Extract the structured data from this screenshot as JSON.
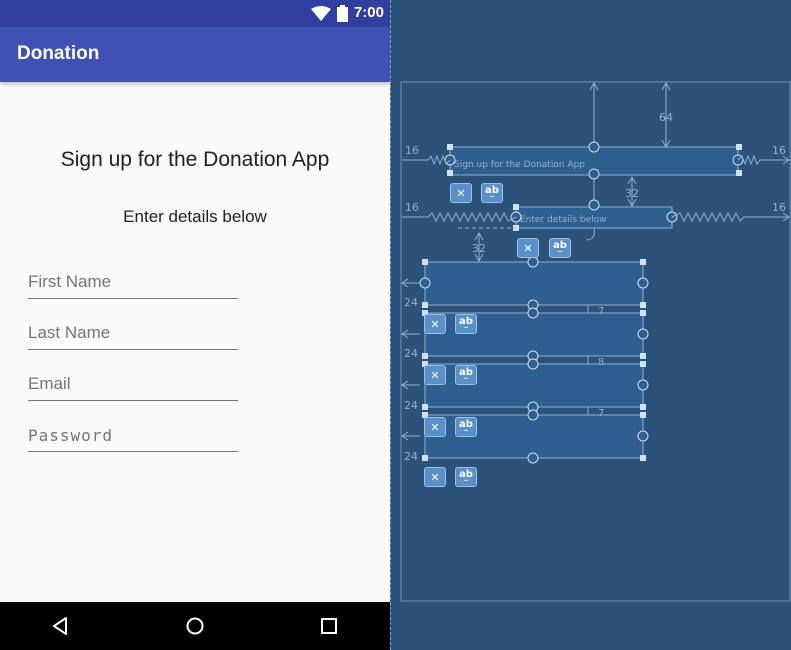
{
  "status_bar": {
    "time": "7:00"
  },
  "app_bar": {
    "title": "Donation"
  },
  "content": {
    "heading": "Sign up for the Donation App",
    "subheading": "Enter details below",
    "fields": {
      "first_name": {
        "placeholder": "First Name"
      },
      "last_name": {
        "placeholder": "Last Name"
      },
      "email": {
        "placeholder": "Email"
      },
      "password": {
        "placeholder": "Password"
      }
    }
  },
  "nav_bar": {
    "icons": [
      "back-icon",
      "home-icon",
      "recents-icon"
    ]
  },
  "blueprint": {
    "margins": {
      "left_top": "16",
      "right_top": "16",
      "left_sub": "16",
      "right_sub": "16",
      "top": "64",
      "between": "32",
      "fields_top": "32"
    },
    "field_margins": [
      "24",
      "24",
      "24",
      "24"
    ],
    "field_gaps": [
      "7",
      "8",
      "7"
    ],
    "labels": {
      "heading": "Sign up for the Donation App",
      "subheading": "Enter details below"
    },
    "tool_labels": {
      "clear": "✕",
      "text": "ab"
    },
    "colors": {
      "background": "#2b5278",
      "widget": "#2f5f8e",
      "line": "#8fb2d6"
    }
  }
}
